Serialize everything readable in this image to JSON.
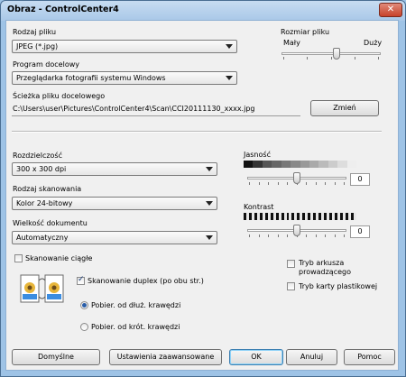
{
  "window": {
    "title": "Obraz - ControlCenter4",
    "close_glyph": "✕"
  },
  "file_type": {
    "label": "Rodzaj pliku",
    "value": "JPEG (*.jpg)"
  },
  "file_size": {
    "label": "Rozmiar pliku",
    "min_label": "Mały",
    "max_label": "Duży",
    "level": 0.55
  },
  "target_app": {
    "label": "Program docelowy",
    "value": "Przeglądarka fotografii systemu Windows"
  },
  "dest_path": {
    "label": "Ścieżka pliku docelowego",
    "value": "C:\\Users\\user\\Pictures\\ControlCenter4\\Scan\\CCI20111130_xxxx.jpg",
    "change_button": "Zmień"
  },
  "resolution": {
    "label": "Rozdzielczość",
    "value": "300 x 300 dpi"
  },
  "scan_type": {
    "label": "Rodzaj skanowania",
    "value": "Kolor 24-bitowy"
  },
  "doc_size": {
    "label": "Wielkość dokumentu",
    "value": "Automatyczny"
  },
  "brightness": {
    "label": "Jasność",
    "value": "0",
    "level": 0.5
  },
  "contrast": {
    "label": "Kontrast",
    "value": "0",
    "level": 0.5
  },
  "continuous_scan": {
    "label": "Skanowanie ciągłe",
    "checked": false
  },
  "duplex": {
    "label": "Skanowanie duplex (po obu str.)",
    "checked": true
  },
  "long_edge": {
    "label": "Pobier. od dłuż. krawędzi",
    "selected": true
  },
  "short_edge": {
    "label": "Pobier. od krót. krawędzi",
    "selected": false
  },
  "carrier_sheet": {
    "label_line1": "Tryb arkusza",
    "label_line2": "prowadzącego",
    "checked": false
  },
  "plastic_card": {
    "label": "Tryb karty plastikowej",
    "checked": false
  },
  "buttons": {
    "default": "Domyślne",
    "advanced": "Ustawienia zaawansowane",
    "ok": "OK",
    "cancel": "Anuluj",
    "help": "Pomoc"
  }
}
